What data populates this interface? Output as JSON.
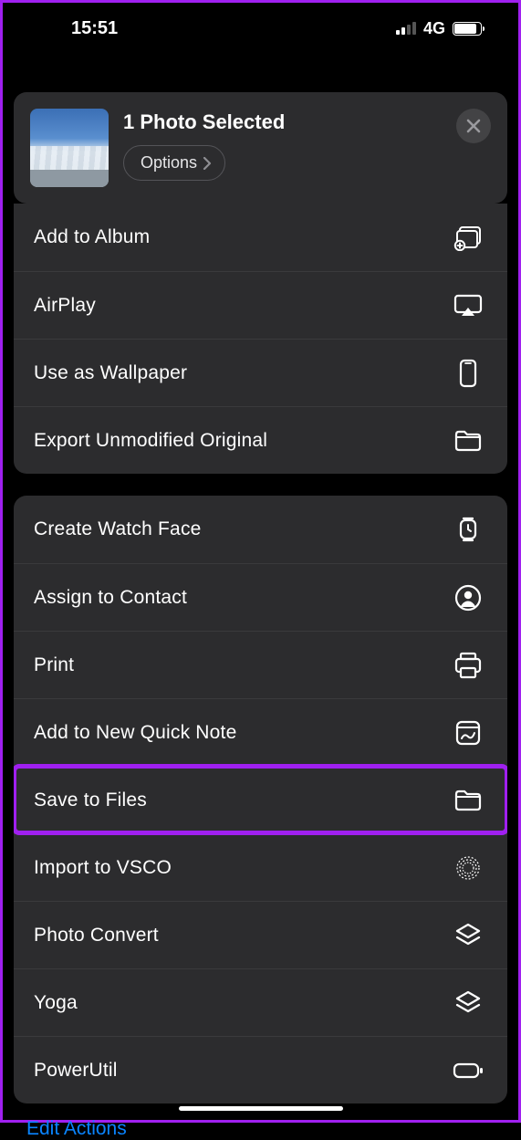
{
  "status": {
    "time": "15:51",
    "network": "4G"
  },
  "header": {
    "title": "1 Photo Selected",
    "options_label": "Options"
  },
  "group1": [
    {
      "label": "Add to Album",
      "icon": "album-icon"
    },
    {
      "label": "AirPlay",
      "icon": "airplay-icon"
    },
    {
      "label": "Use as Wallpaper",
      "icon": "phone-icon"
    },
    {
      "label": "Export Unmodified Original",
      "icon": "folder-icon"
    }
  ],
  "group2": [
    {
      "label": "Create Watch Face",
      "icon": "watch-icon"
    },
    {
      "label": "Assign to Contact",
      "icon": "contact-icon"
    },
    {
      "label": "Print",
      "icon": "printer-icon"
    },
    {
      "label": "Add to New Quick Note",
      "icon": "quicknote-icon"
    },
    {
      "label": "Save to Files",
      "icon": "folder-icon",
      "highlighted": true
    },
    {
      "label": "Import to VSCO",
      "icon": "vsco-icon"
    },
    {
      "label": "Photo Convert",
      "icon": "stack-icon"
    },
    {
      "label": "Yoga",
      "icon": "stack-icon"
    },
    {
      "label": "PowerUtil",
      "icon": "battery-icon"
    }
  ],
  "footer": {
    "edit_actions": "Edit Actions"
  }
}
